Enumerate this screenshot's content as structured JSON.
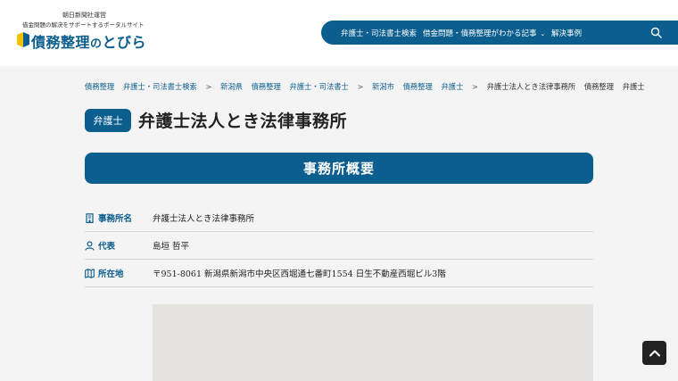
{
  "header": {
    "tagline_1": "朝日新聞社運営",
    "tagline_2": "借金問題の解決をサポートするポータルサイト",
    "logo_text": "債務整理",
    "logo_text_small": "の",
    "logo_text_end": "とびら"
  },
  "nav": {
    "items": [
      {
        "label": "弁護士・司法書士検索"
      },
      {
        "label": "借金問題・債務整理がわかる記事"
      },
      {
        "label": "解決事例"
      }
    ],
    "search_icon": "search-icon"
  },
  "breadcrumb": [
    "債務整理",
    "弁護士・司法書士検索",
    "新潟県",
    "債務整理",
    "弁護士・司法書士",
    "新潟市",
    "債務整理",
    "弁護士",
    "弁護士法人とき法律事務所",
    "債務整理",
    "弁護士"
  ],
  "title": {
    "badge": "弁護士",
    "name": "弁護士法人とき法律事務所"
  },
  "section": {
    "heading": "事務所概要"
  },
  "info": [
    {
      "icon": "building-icon",
      "label": "事務所名",
      "value": "弁護士法人とき法律事務所"
    },
    {
      "icon": "person-icon",
      "label": "代表",
      "value": "島垣 哲平"
    },
    {
      "icon": "map-icon",
      "label": "所在地",
      "value": "〒951-8061 新潟県新潟市中央区西堀通七番町1554 日生不動産西堀ビル3階"
    }
  ],
  "colors": {
    "brand": "#0b5e8e",
    "accent": "#f2c200",
    "background": "#f4f4f4"
  }
}
